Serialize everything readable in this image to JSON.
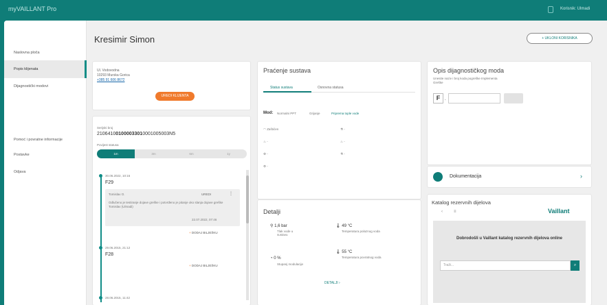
{
  "app": {
    "title": "myVAILLANT Pro",
    "user_label": "Korisnik: Ulmadi"
  },
  "sidebar": {
    "items": [
      {
        "label": "Naslovna ploča"
      },
      {
        "label": "Popis klijenata"
      },
      {
        "label": "Dijagnostički modovi"
      },
      {
        "label": "Pomoć i povratne informacije"
      },
      {
        "label": "Postavke"
      },
      {
        "label": "Odjava"
      }
    ]
  },
  "header": {
    "title": "Kresimir Simon",
    "add_user_label": "+ UKLONI KORISNIKA"
  },
  "customer": {
    "street": "Ul. Vodovodna",
    "city": "10293 Murska Gorica",
    "phone": "+385 91 606 8672",
    "edit_label": "UREDI KLIJENTA"
  },
  "serial": {
    "label": "Serijski broj",
    "value_prefix": "2106410",
    "value_bold": "0100003301",
    "value_suffix": "0001005003N5",
    "history_label": "Povijest statusa",
    "segments": [
      "1m",
      "3m",
      "6m",
      "1y"
    ]
  },
  "timeline": [
    {
      "date": "30.06.2022, 10:16",
      "code": "F29",
      "author": "Tomislav O.",
      "tag": "UREDI",
      "note": "Odlučeno je testiranje dojave greške i potvrđeno je pitanje oko slanja dojave greške Tomislav (Ulmadi)",
      "note_date": "22.07.2022, 07:46",
      "add_label": "DODAJ BILJEŠKU"
    },
    {
      "date": "29.06.2015, 21:12",
      "code": "F28",
      "add_label": "DODAJ BILJEŠKU"
    },
    {
      "date": "28.06.2015, 11:42"
    }
  ],
  "monitoring": {
    "title": "Praćenje sustava",
    "tabs": [
      "Status sustava",
      "Osnovna statusa"
    ],
    "mode_label": "Mod:",
    "mode_values": [
      "Normalni PPT",
      "Grijanje",
      "Priprema tople vode"
    ],
    "rows_left": [
      "Zaštićen",
      "-",
      "-",
      "-"
    ],
    "rows_right": [
      "-",
      "-",
      "-"
    ]
  },
  "details": {
    "title": "Detalji",
    "items": [
      {
        "value": "1,6 bar",
        "label": "Tlak vode u sustavu"
      },
      {
        "value": "49 °C",
        "label": "Temperatura polaznog voda"
      },
      {
        "value": "0 %",
        "label": "Stupanj modulacije"
      },
      {
        "value": "55 °C",
        "label": "Temperatura povratnog voda"
      }
    ],
    "link_label": "DETALJI"
  },
  "diag": {
    "title": "Opis dijagnostičkog moda",
    "hint": "Unesite naziv i broj koda pogreške Implementa Greške",
    "prefix": "F",
    "input_value": ""
  },
  "docs": {
    "label": "Dokumentacija"
  },
  "catalog": {
    "title": "Katalog rezervnih dijelova",
    "brand": "Vaillant",
    "welcome": "Dobrodošli u Vaillant katalog rezervnih dijelova online",
    "search_placeholder": "Traži..."
  },
  "colors": {
    "accent": "#0f7d78",
    "orange": "#f07a2c",
    "background": "#f0f0f0"
  }
}
